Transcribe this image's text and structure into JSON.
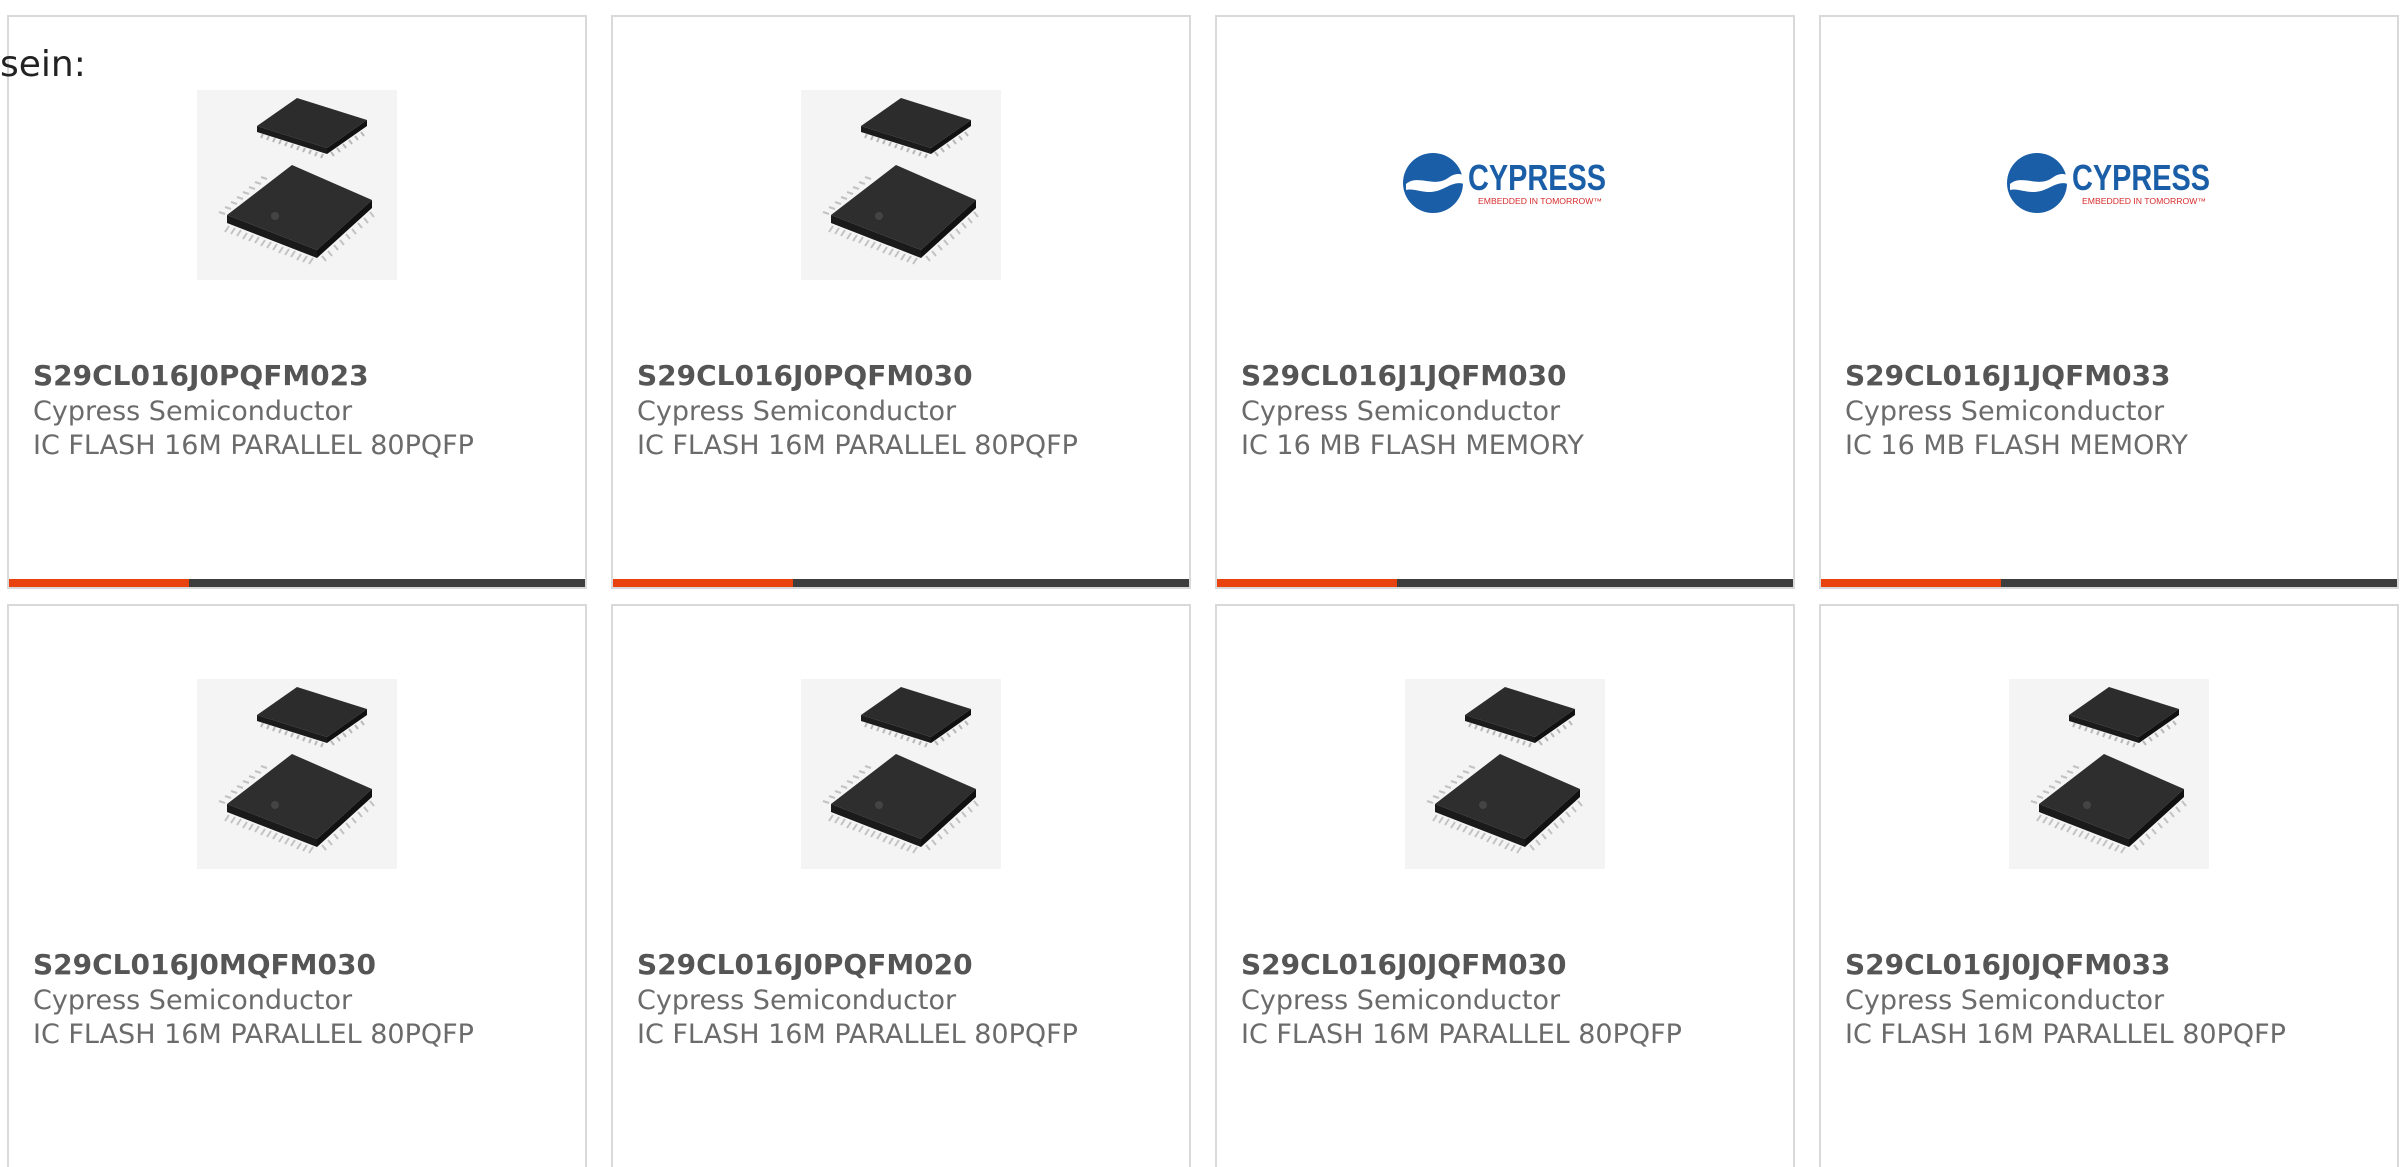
{
  "intro_text": "sein:",
  "colors": {
    "accent": "#e8430e",
    "bar_dark": "#3d3d3d",
    "card_border": "#d9d9d9",
    "cypress_blue": "#1a5ea8",
    "cypress_red": "#d62b2b"
  },
  "products": [
    {
      "part_number": "S29CL016J0PQFM023",
      "manufacturer": "Cypress Semiconductor",
      "description": "IC FLASH 16M PARALLEL 80PQFP",
      "image": "chip-package-icon"
    },
    {
      "part_number": "S29CL016J0PQFM030",
      "manufacturer": "Cypress Semiconductor",
      "description": "IC FLASH 16M PARALLEL 80PQFP",
      "image": "chip-package-icon"
    },
    {
      "part_number": "S29CL016J1JQFM030",
      "manufacturer": "Cypress Semiconductor",
      "description": "IC 16 MB FLASH MEMORY",
      "image": "cypress-logo",
      "logo_text": "CYPRESS",
      "logo_tagline": "EMBEDDED IN TOMORROW™"
    },
    {
      "part_number": "S29CL016J1JQFM033",
      "manufacturer": "Cypress Semiconductor",
      "description": "IC 16 MB FLASH MEMORY",
      "image": "cypress-logo",
      "logo_text": "CYPRESS",
      "logo_tagline": "EMBEDDED IN TOMORROW™"
    },
    {
      "part_number": "S29CL016J0MQFM030",
      "manufacturer": "Cypress Semiconductor",
      "description": "IC FLASH 16M PARALLEL 80PQFP",
      "image": "chip-package-icon"
    },
    {
      "part_number": "S29CL016J0PQFM020",
      "manufacturer": "Cypress Semiconductor",
      "description": "IC FLASH 16M PARALLEL 80PQFP",
      "image": "chip-package-icon"
    },
    {
      "part_number": "S29CL016J0JQFM030",
      "manufacturer": "Cypress Semiconductor",
      "description": "IC FLASH 16M PARALLEL 80PQFP",
      "image": "chip-package-icon"
    },
    {
      "part_number": "S29CL016J0JQFM033",
      "manufacturer": "Cypress Semiconductor",
      "description": "IC FLASH 16M PARALLEL 80PQFP",
      "image": "chip-package-icon"
    }
  ]
}
